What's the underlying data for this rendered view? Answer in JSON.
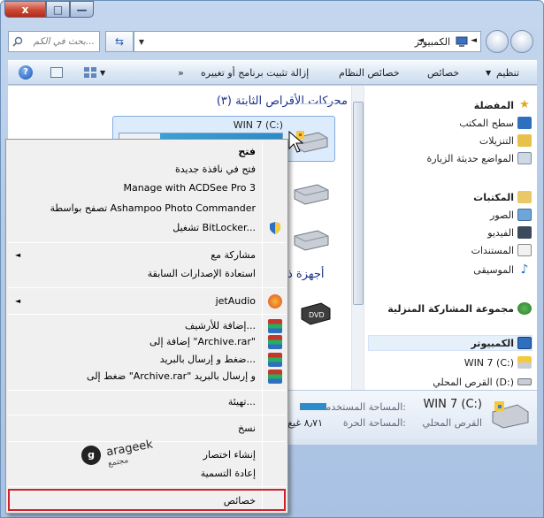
{
  "window": {
    "buttons": {
      "close": "x",
      "maximize": "□",
      "minimize": "—"
    }
  },
  "address_bar": {
    "search_placeholder": "بحث في الكم...",
    "breadcrumb": "الكمبيوتر",
    "arrow": "◄",
    "dropdown": "▼"
  },
  "toolbar": {
    "organize": "تنظيم",
    "properties": "خصائص",
    "system_properties": "خصائص النظام",
    "uninstall": "إزالة تثبيت برنامج أو تغييره",
    "more": "»",
    "view_dropdown": "▼",
    "help": "?"
  },
  "nav_pane": {
    "favorites": "المفضلة",
    "desktop": "سطح المكتب",
    "downloads": "التنزيلات",
    "recent": "المواضع حديثة الزيارة",
    "libraries": "المكتبات",
    "pictures": "الصور",
    "videos": "الفيديو",
    "documents": "المستندات",
    "music": "الموسيقى",
    "homegroup": "مجموعة المشاركة المنزلية",
    "computer": "الكمبيوتر",
    "drive_c": "WIN 7 (C:)",
    "drive_d": "القرص المحلي (D:)"
  },
  "main": {
    "hard_drives_title": "محركات الأقراص الثابتة (٣)",
    "drive_c_label": "WIN 7 (C:)",
    "devices_title_partial": "أجهزة ذ"
  },
  "details": {
    "name": "WIN 7 (C:)",
    "type": "القرص المحلي",
    "used_label": "المساحة المستخدمة:",
    "free_label": "المساحة الحرة:",
    "free_value": "٨٫٧١ غيغ"
  },
  "context_menu": {
    "open": "فتح",
    "open_new_window": "فتح في نافذة جديدة",
    "acdsee": "Manage with ACDSee Pro 3",
    "ashampoo": "تصفح بواسطة Ashampoo Photo Commander",
    "bitlocker": "تشغيل BitLocker...",
    "share_with": "مشاركة مع",
    "restore_versions": "استعادة الإصدارات السابقة",
    "jetaudio": "jetAudio",
    "add_to_archive": "إضافة للأرشيف...",
    "add_to_archive_rar": "إضافة إلى \"Archive.rar\"",
    "compress_email": "ضغط و إرسال بالبريد...",
    "compress_rar_email": "ضغط إلى \"Archive.rar\" و إرسال بالبريد",
    "format": "تهيئة...",
    "copy": "نسخ",
    "create_shortcut": "إنشاء اختصار",
    "rename": "إعادة التسمية",
    "properties": "خصائص",
    "submenu_arrow": "◄"
  },
  "watermark": {
    "logo": "g",
    "brand": "arageek",
    "subtitle": "مجتمع"
  },
  "colors": {
    "accent_blue": "#1e3287",
    "highlight_red": "#d1202b",
    "drive_bar": "#2a8cc8"
  }
}
